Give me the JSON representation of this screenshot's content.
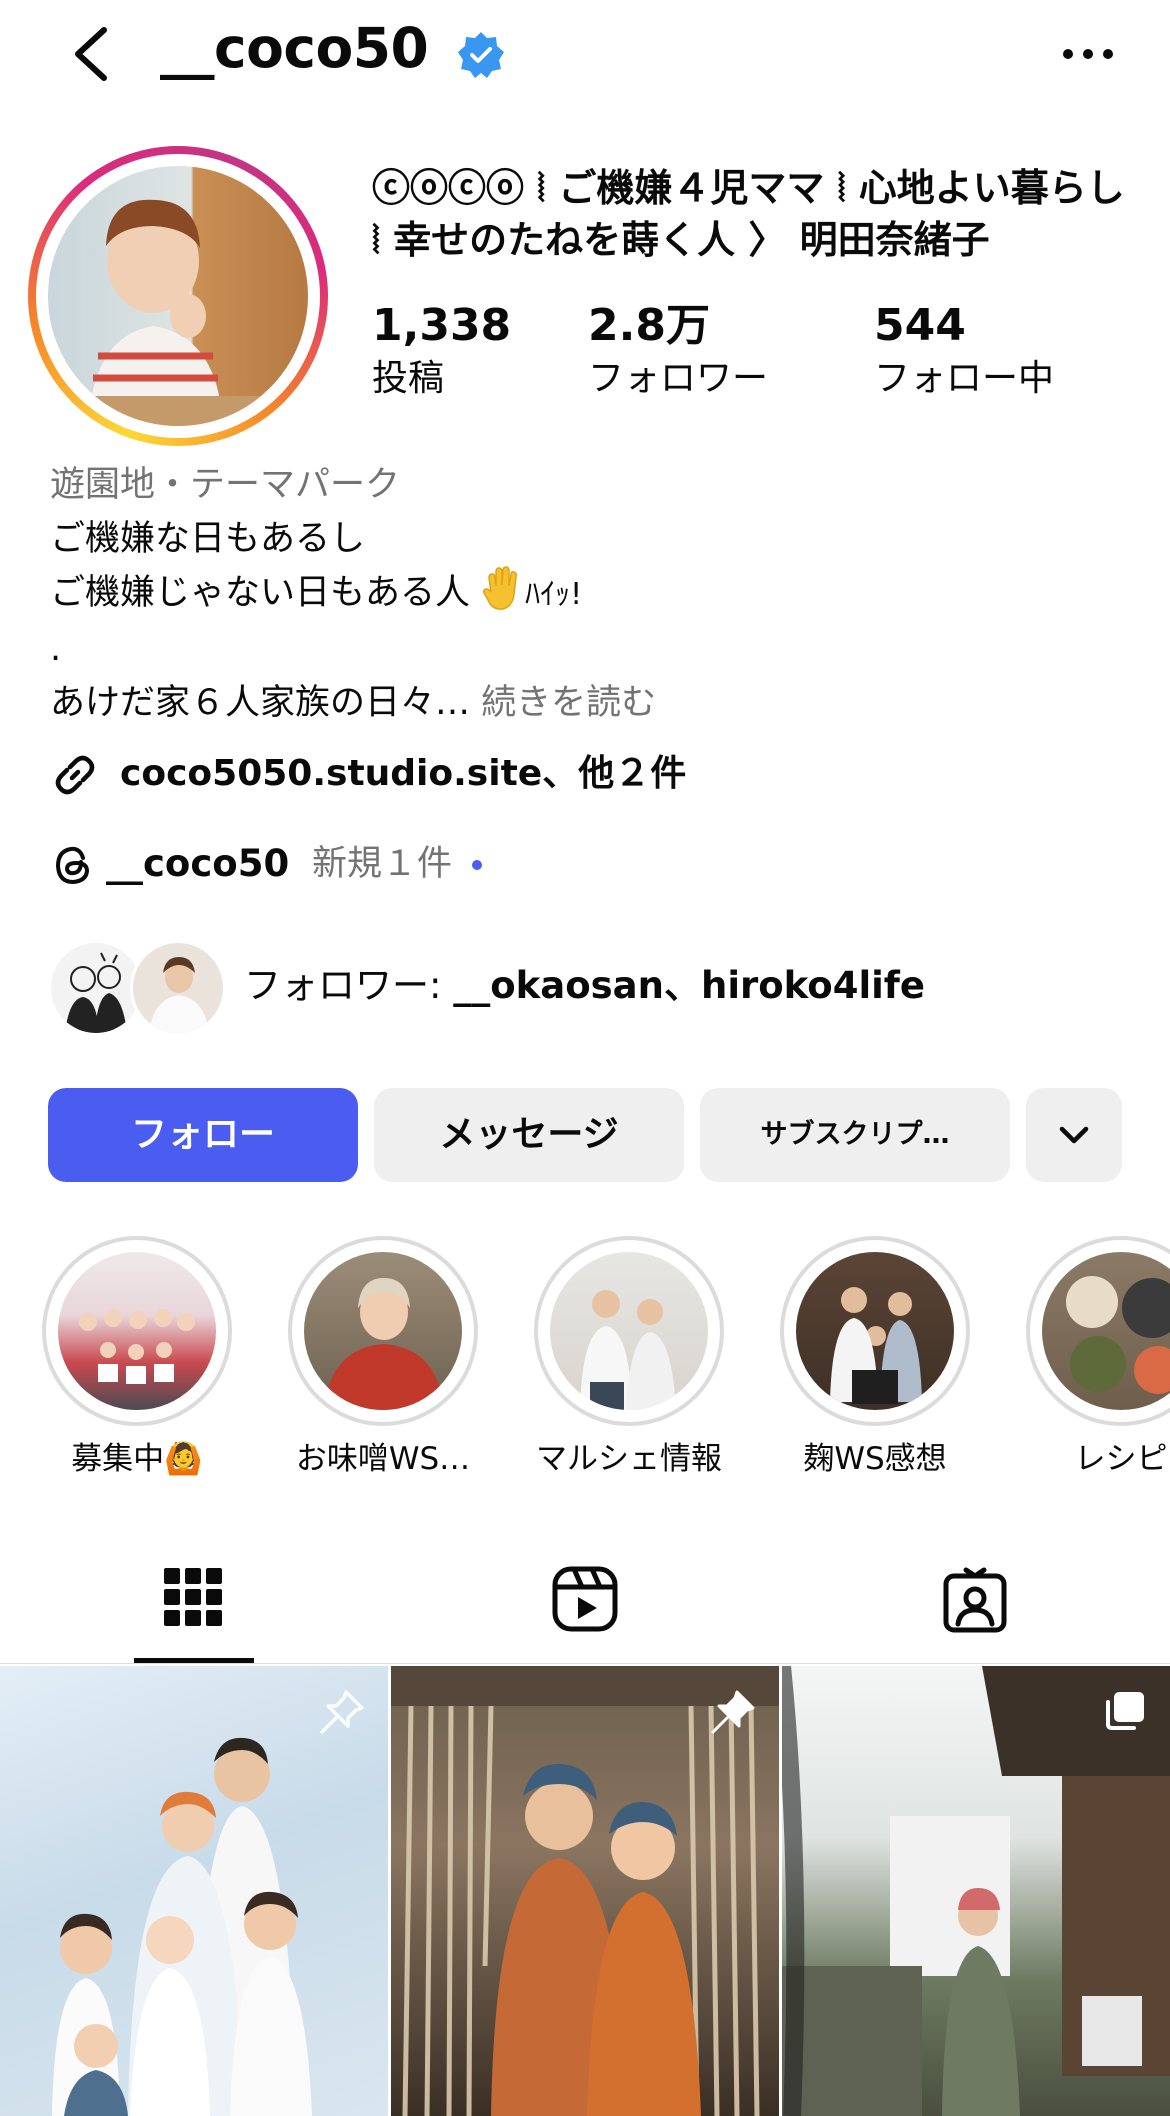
{
  "header": {
    "username": "__coco50",
    "verified_icon": "verified-badge-icon",
    "back_icon": "chevron-left-icon",
    "more_icon": "ellipsis-icon"
  },
  "profile": {
    "full_name": "ⓒⓞⓒⓞ ⦚ ご機嫌４児ママ ⦚ 心地よい暮らし ⦚ 幸せのたねを蒔く人 〉 明田奈緒子",
    "stats": [
      {
        "value": "1,338",
        "label": "投稿"
      },
      {
        "value": "2.8万",
        "label": "フォロワー"
      },
      {
        "value": "544",
        "label": "フォロー中"
      }
    ],
    "category": "遊園地・テーマパーク",
    "bio_line1": "ご機嫌な日もあるし",
    "bio_line2": "ご機嫌じゃない日もある人",
    "bio_line2_suffix": "ﾊｲｯ!",
    "bio_line3": ".",
    "bio_line4": "あけだ家６人家族の日々…",
    "more_link": "続きを読む",
    "link": "coco5050.studio.site、他２件",
    "threads_name": "__coco50",
    "threads_new": "新規１件",
    "mutual_prefix": "フォロワー: ",
    "mutual_names": "__okaosan、hiroko4life"
  },
  "actions": {
    "follow": "フォロー",
    "message": "メッセージ",
    "subscribe": "サブスクリプ…",
    "more_icon": "chevron-down-icon"
  },
  "highlights": [
    {
      "label": "募集中🙆"
    },
    {
      "label": "お味噌WS…"
    },
    {
      "label": "マルシェ情報"
    },
    {
      "label": "麹WS感想"
    },
    {
      "label": "レシピ"
    }
  ],
  "tabs": [
    {
      "name": "grid-icon",
      "active": true
    },
    {
      "name": "reels-icon",
      "active": false
    },
    {
      "name": "tagged-icon",
      "active": false
    }
  ],
  "colors": {
    "follow_button": "#4b5cf0",
    "verified": "#3897f0",
    "secondary_text": "#737373"
  }
}
